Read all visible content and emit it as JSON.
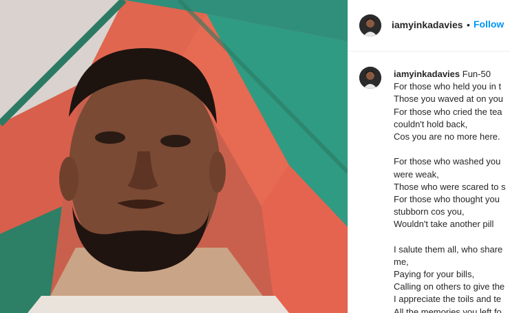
{
  "post": {
    "username": "iamyinkadavies",
    "follow_label": "Follow",
    "separator": "•",
    "caption_title": "Fun-50",
    "caption_lines": [
      "For those who held you in t",
      "Those you waved at on you",
      "For those who cried the tea",
      "couldn't hold back,",
      "Cos you are no more here.",
      "",
      "For those who washed you",
      "were weak,",
      "Those who were scared to s",
      "For those who thought you",
      "stubborn cos you,",
      "Wouldn't take another pill",
      "",
      "I salute them all, who share",
      "me,",
      "Paying for your bills,",
      "Calling on others to give the",
      "I appreciate the toils and te",
      "All the memories you left fo"
    ]
  },
  "icons": {
    "avatar": "profile-avatar",
    "photo": "selfie-photo"
  },
  "colors": {
    "follow": "#0095f6",
    "text": "#262626",
    "border": "#efefef"
  }
}
